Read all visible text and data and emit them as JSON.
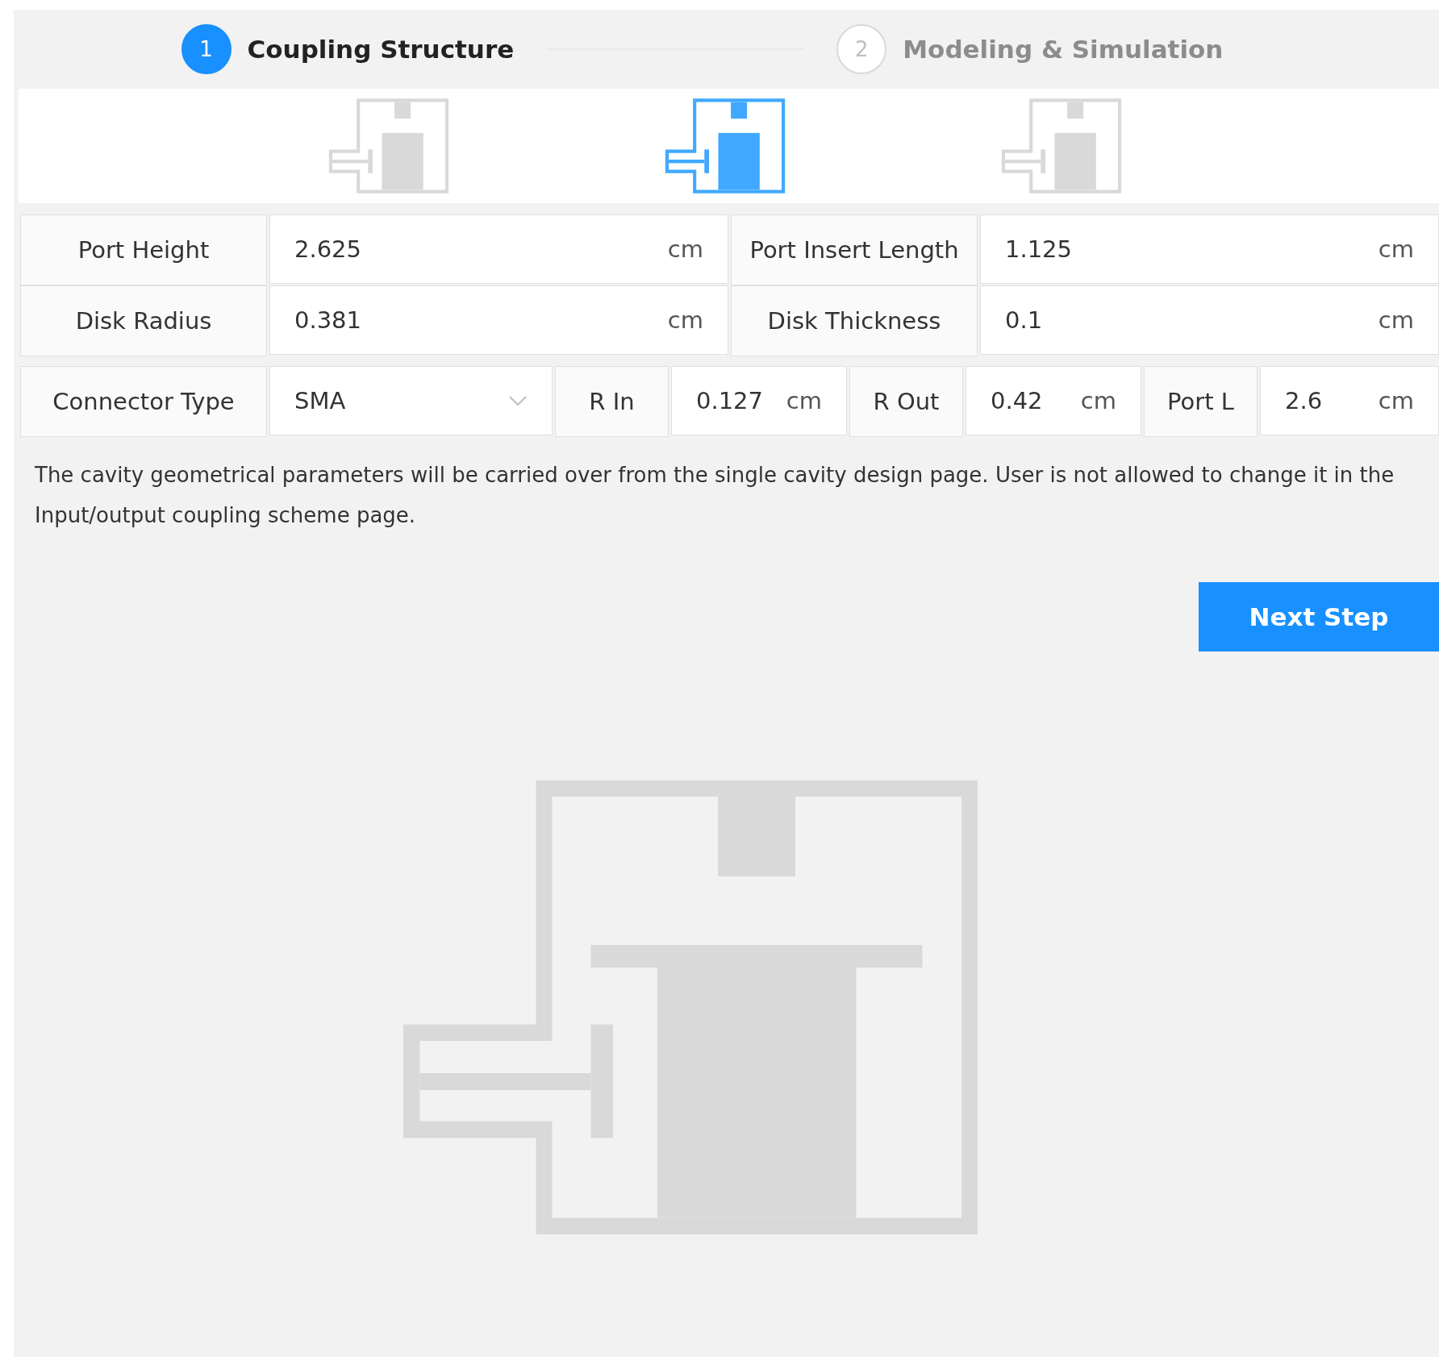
{
  "steps": [
    {
      "number": "1",
      "title": "Coupling Structure",
      "selected": true
    },
    {
      "number": "2",
      "title": "Modeling & Simulation",
      "selected": false
    }
  ],
  "structures": [
    {
      "selected": false
    },
    {
      "selected": true
    },
    {
      "selected": false
    }
  ],
  "field_rows": [
    [
      {
        "label": "Port Height",
        "value": "2.625",
        "unit": "cm"
      },
      {
        "label": "Port Insert Length",
        "value": "1.125",
        "unit": "cm"
      }
    ],
    [
      {
        "label": "Disk Radius",
        "value": "0.381",
        "unit": "cm"
      },
      {
        "label": "Disk Thickness",
        "value": "0.1",
        "unit": "cm"
      }
    ]
  ],
  "connector": {
    "label": "Connector Type",
    "value": "SMA"
  },
  "connector_fields": [
    {
      "label": "R In",
      "value": "0.127",
      "unit": "cm"
    },
    {
      "label": "R Out",
      "value": "0.42",
      "unit": "cm"
    },
    {
      "label": "Port L",
      "value": "2.6",
      "unit": "cm"
    }
  ],
  "note": "The cavity geometrical parameters will be carried over from the single cavity design page. User is not allowed to change it in the Input/output coupling scheme page.",
  "next_button": "Next Step"
}
